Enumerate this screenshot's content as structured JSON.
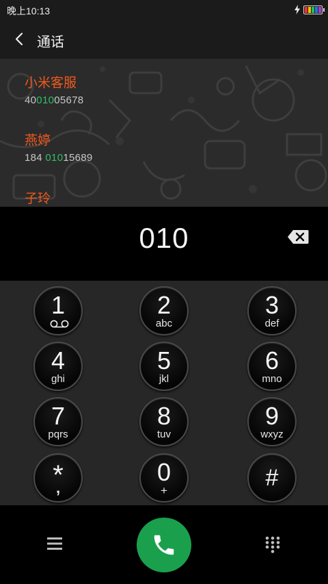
{
  "status_bar": {
    "time": "晚上10:13",
    "battery_colors": [
      "#e33",
      "#f2c200",
      "#2bbd4f",
      "#1e7df0",
      "#b03cd0"
    ]
  },
  "header": {
    "title": "通话"
  },
  "search": {
    "query": "010",
    "results": [
      {
        "name": "小米客服",
        "number_pre": "40",
        "number_match": "010",
        "number_post": "05678"
      },
      {
        "name": "燕婷",
        "number_pre": "184 ",
        "number_match": "010",
        "number_post": "15689"
      },
      {
        "name": "子玲"
      }
    ]
  },
  "keypad": {
    "keys": [
      {
        "digit": "1",
        "letters": "",
        "icon": "voicemail-icon"
      },
      {
        "digit": "2",
        "letters": "abc"
      },
      {
        "digit": "3",
        "letters": "def"
      },
      {
        "digit": "4",
        "letters": "ghi"
      },
      {
        "digit": "5",
        "letters": "jkl"
      },
      {
        "digit": "6",
        "letters": "mno"
      },
      {
        "digit": "7",
        "letters": "pqrs"
      },
      {
        "digit": "8",
        "letters": "tuv"
      },
      {
        "digit": "9",
        "letters": "wxyz"
      },
      {
        "digit": "*",
        "letters": ","
      },
      {
        "digit": "0",
        "letters": "+"
      },
      {
        "digit": "#",
        "letters": ""
      }
    ]
  },
  "bottom_bar": {
    "menu_icon": "menu-icon",
    "call_icon": "phone-icon",
    "dialpad_icon": "dialpad-icon"
  },
  "colors": {
    "accent_orange": "#ef5a1e",
    "match_green": "#2dbf6a",
    "call_green": "#1aa04d"
  }
}
